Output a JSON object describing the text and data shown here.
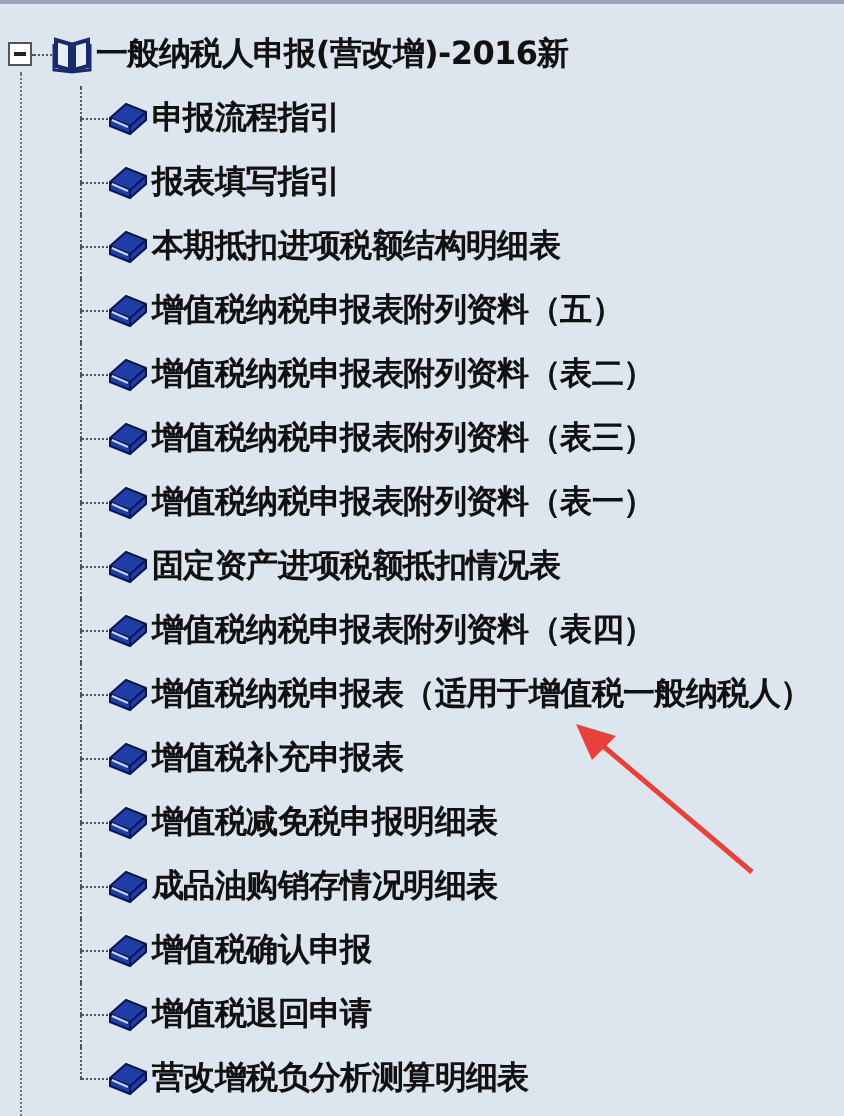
{
  "tree": {
    "label": "一般纳税人申报(营改增)-2016新",
    "expanded": true,
    "children": [
      {
        "label": "申报流程指引"
      },
      {
        "label": "报表填写指引"
      },
      {
        "label": "本期抵扣进项税额结构明细表"
      },
      {
        "label": "增值税纳税申报表附列资料（五）"
      },
      {
        "label": "增值税纳税申报表附列资料（表二）"
      },
      {
        "label": "增值税纳税申报表附列资料（表三）"
      },
      {
        "label": "增值税纳税申报表附列资料（表一）"
      },
      {
        "label": "固定资产进项税额抵扣情况表"
      },
      {
        "label": "增值税纳税申报表附列资料（表四）"
      },
      {
        "label": "增值税纳税申报表（适用于增值税一般纳税人）"
      },
      {
        "label": "增值税补充申报表"
      },
      {
        "label": "增值税减免税申报明细表"
      },
      {
        "label": "成品油购销存情况明细表"
      },
      {
        "label": "增值税确认申报"
      },
      {
        "label": "增值税退回申请"
      },
      {
        "label": "营改增税负分析测算明细表"
      }
    ]
  }
}
